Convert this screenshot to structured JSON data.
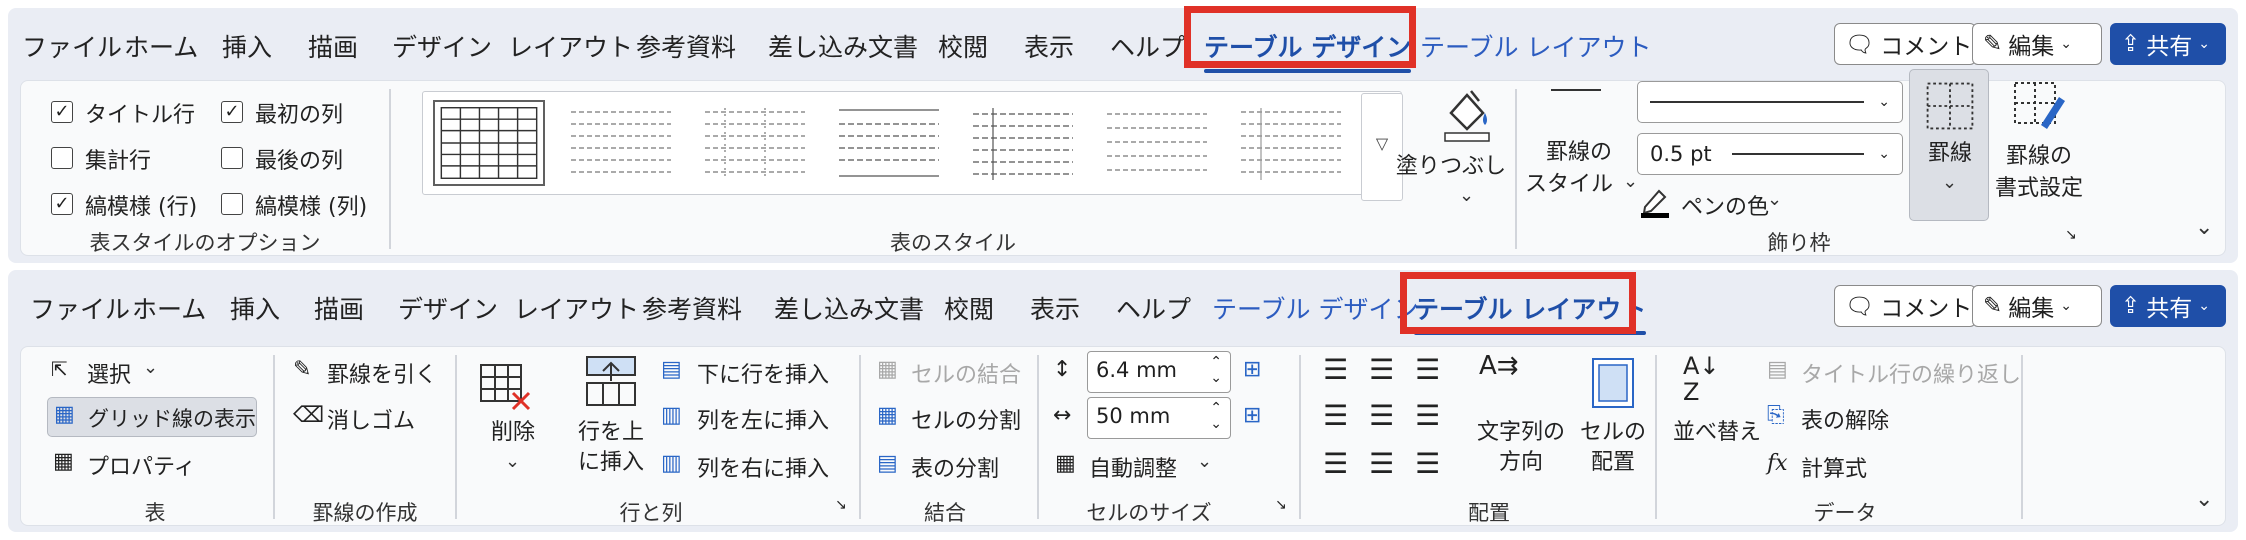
{
  "ribbon_top": {
    "tabs": [
      "ファイル",
      "ホーム",
      "挿入",
      "描画",
      "デザイン",
      "レイアウト",
      "参考資料",
      "差し込み文書",
      "校閲",
      "表示",
      "ヘルプ",
      "テーブル デザイン",
      "テーブル レイアウト"
    ],
    "active_tab": "テーブル デザイン",
    "comment_label": "コメント",
    "edit_label": "編集",
    "share_label": "共有",
    "style_options": {
      "header_row": "タイトル行",
      "first_column": "最初の列",
      "total_row": "集計行",
      "last_column": "最後の列",
      "banded_rows": "縞模様 (行)",
      "banded_columns": "縞模様 (列)",
      "checked": {
        "header_row": true,
        "first_column": true,
        "total_row": false,
        "last_column": false,
        "banded_rows": true,
        "banded_columns": false
      },
      "group_label": "表スタイルのオプション"
    },
    "table_styles": {
      "group_label": "表のスタイル"
    },
    "shading_label": "塗りつぶし",
    "borders": {
      "border_style_line1": "罫線の",
      "border_style_line2": "スタイル",
      "pen_weight": "0.5 pt",
      "pen_color": "ペンの色",
      "borders_button": "罫線",
      "painter_line1": "罫線の",
      "painter_line2": "書式設定",
      "group_label": "飾り枠"
    }
  },
  "ribbon_bottom": {
    "tabs": [
      "ファイル",
      "ホーム",
      "挿入",
      "描画",
      "デザイン",
      "レイアウト",
      "参考資料",
      "差し込み文書",
      "校閲",
      "表示",
      "ヘルプ",
      "テーブル デザイン",
      "テーブル レイアウト"
    ],
    "active_tab": "テーブル レイアウト",
    "comment_label": "コメント",
    "edit_label": "編集",
    "share_label": "共有",
    "table_group": {
      "select": "選択",
      "gridlines": "グリッド線の表示",
      "properties": "プロパティ",
      "label": "表"
    },
    "draw_group": {
      "draw_table": "罫線を引く",
      "eraser": "消しゴム",
      "label": "罫線の作成"
    },
    "rows_cols_group": {
      "delete": "削除",
      "insert_above_line1": "行を上",
      "insert_above_line2": "に挿入",
      "insert_below": "下に行を挿入",
      "insert_left": "列を左に挿入",
      "insert_right": "列を右に挿入",
      "label": "行と列"
    },
    "merge_group": {
      "merge_cells": "セルの結合",
      "split_cells": "セルの分割",
      "split_table": "表の分割",
      "label": "結合"
    },
    "cell_size_group": {
      "height": "6.4 mm",
      "width": "50 mm",
      "autofit": "自動調整",
      "label": "セルのサイズ"
    },
    "alignment_group": {
      "text_direction_line1": "文字列の",
      "text_direction_line2": "方向",
      "cell_margins_line1": "セルの",
      "cell_margins_line2": "配置",
      "label": "配置"
    },
    "data_group": {
      "sort": "並べ替え",
      "repeat_header": "タイトル行の繰り返し",
      "convert_to_text": "表の解除",
      "formula": "計算式",
      "label": "データ"
    }
  },
  "colors": {
    "accent": "#1f4fa8",
    "highlight": "#e03127",
    "ribbon_bg": "#eaedf4"
  }
}
